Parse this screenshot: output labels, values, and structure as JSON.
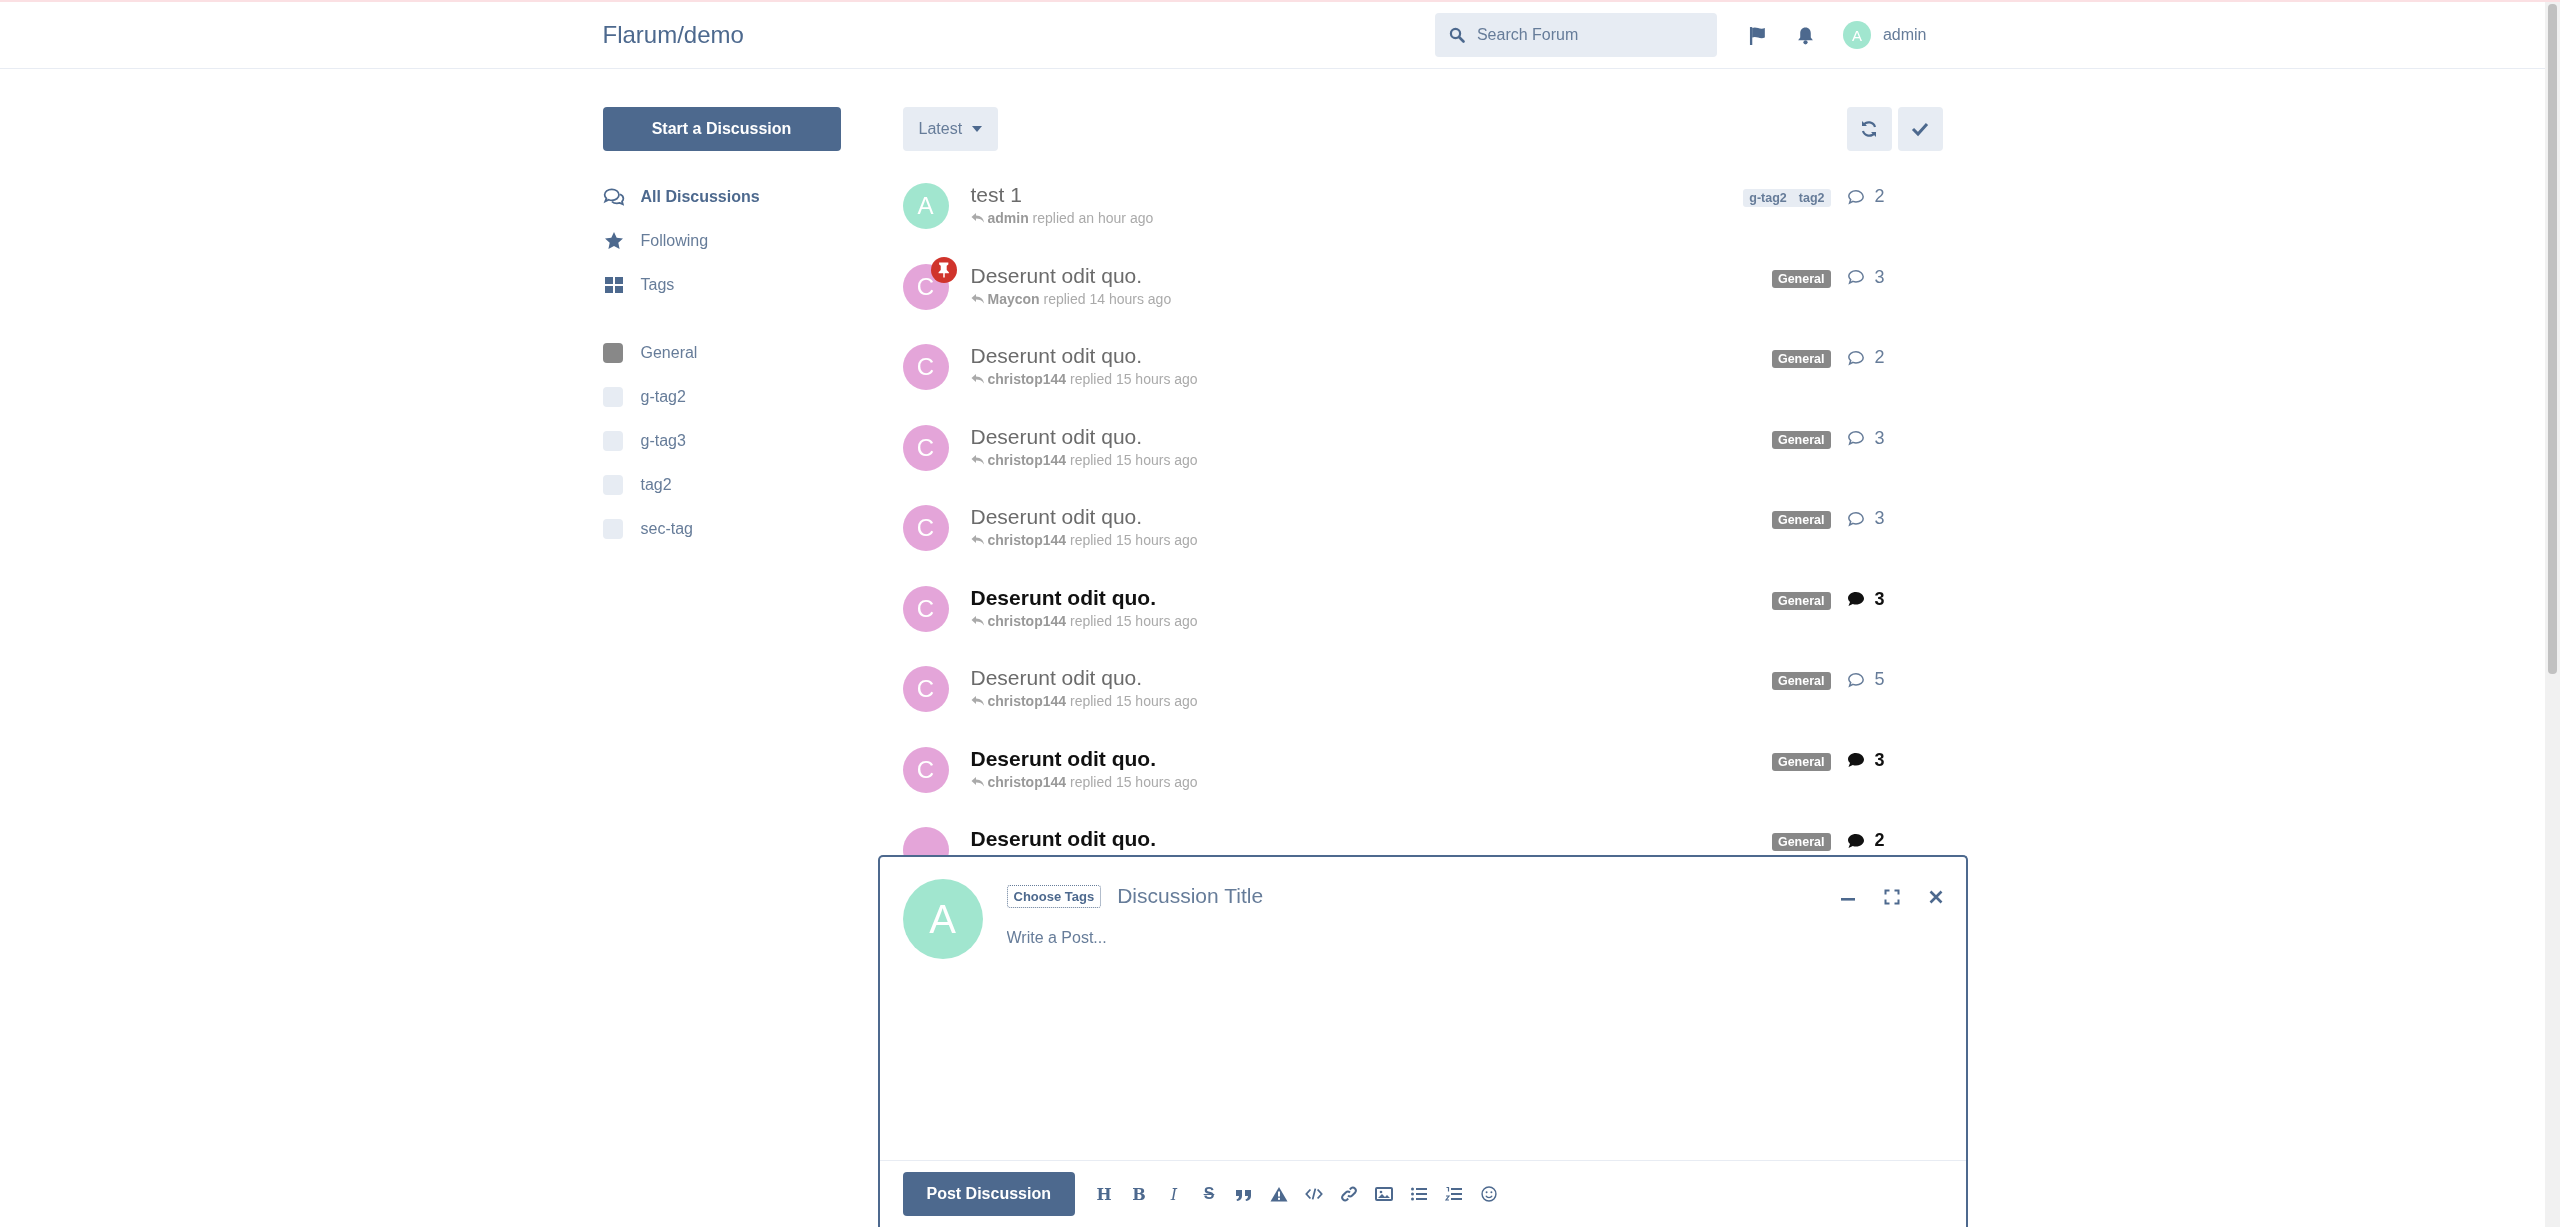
{
  "header": {
    "title": "Flarum/demo",
    "search": {
      "placeholder": "Search Forum"
    },
    "user": {
      "avatar_letter": "A",
      "name": "admin"
    }
  },
  "sidebar": {
    "start_button": "Start a Discussion",
    "nav": [
      {
        "label": "All Discussions",
        "kind": "discussions",
        "selected": true
      },
      {
        "label": "Following",
        "kind": "following",
        "selected": false
      },
      {
        "label": "Tags",
        "kind": "tags",
        "selected": false
      }
    ],
    "tags": [
      {
        "label": "General",
        "color": "#888888"
      },
      {
        "label": "g-tag2"
      },
      {
        "label": "g-tag3"
      },
      {
        "label": "tag2"
      },
      {
        "label": "sec-tag"
      }
    ]
  },
  "toolbar": {
    "sort": "Latest"
  },
  "discussions": [
    {
      "title": "test 1",
      "avatar": {
        "letter": "A",
        "color": "#a1e6cf"
      },
      "pinned": false,
      "unread": false,
      "meta": "**admin** replied an hour ago",
      "tags": [
        {
          "label": "g-tag2"
        },
        {
          "label": "tag2"
        }
      ],
      "replies": "2"
    },
    {
      "title": "Deserunt odit quo.",
      "avatar": {
        "letter": "C",
        "color": "#e4a5d9"
      },
      "pinned": true,
      "unread": false,
      "meta": "**Maycon** replied 14 hours ago",
      "tags": [
        {
          "label": "General",
          "color": "#888888"
        }
      ],
      "replies": "3"
    },
    {
      "title": "Deserunt odit quo.",
      "avatar": {
        "letter": "C",
        "color": "#e4a5d9"
      },
      "pinned": false,
      "unread": false,
      "meta": "**christop144** replied 15 hours ago",
      "tags": [
        {
          "label": "General",
          "color": "#888888"
        }
      ],
      "replies": "2"
    },
    {
      "title": "Deserunt odit quo.",
      "avatar": {
        "letter": "C",
        "color": "#e4a5d9"
      },
      "pinned": false,
      "unread": false,
      "meta": "**christop144** replied 15 hours ago",
      "tags": [
        {
          "label": "General",
          "color": "#888888"
        }
      ],
      "replies": "3"
    },
    {
      "title": "Deserunt odit quo.",
      "avatar": {
        "letter": "C",
        "color": "#e4a5d9"
      },
      "pinned": false,
      "unread": false,
      "meta": "**christop144** replied 15 hours ago",
      "tags": [
        {
          "label": "General",
          "color": "#888888"
        }
      ],
      "replies": "3"
    },
    {
      "title": "Deserunt odit quo.",
      "avatar": {
        "letter": "C",
        "color": "#e4a5d9"
      },
      "pinned": false,
      "unread": true,
      "meta": "**christop144** replied 15 hours ago",
      "tags": [
        {
          "label": "General",
          "color": "#888888"
        }
      ],
      "replies": "3"
    },
    {
      "title": "Deserunt odit quo.",
      "avatar": {
        "letter": "C",
        "color": "#e4a5d9"
      },
      "pinned": false,
      "unread": false,
      "meta": "**christop144** replied 15 hours ago",
      "tags": [
        {
          "label": "General",
          "color": "#888888"
        }
      ],
      "replies": "5"
    },
    {
      "title": "Deserunt odit quo.",
      "avatar": {
        "letter": "C",
        "color": "#e4a5d9"
      },
      "pinned": false,
      "unread": true,
      "meta": "**christop144** replied 15 hours ago",
      "tags": [
        {
          "label": "General",
          "color": "#888888"
        }
      ],
      "replies": "3"
    },
    {
      "title": "Deserunt odit quo.",
      "avatar": {
        "color": "#e4a5d9"
      },
      "pinned": false,
      "unread": true,
      "tags": [
        {
          "label": "General",
          "color": "#888888"
        }
      ],
      "replies": "2"
    }
  ],
  "composer": {
    "avatar": {
      "letter": "A",
      "color": "#a1e6cf"
    },
    "tags_button": "Choose Tags",
    "title_placeholder": "Discussion Title",
    "body_placeholder": "Write a Post...",
    "submit": "Post Discussion",
    "tools": [
      {
        "kind": "heading",
        "label": "H"
      },
      {
        "kind": "bold",
        "label": "B"
      },
      {
        "kind": "italic",
        "label": "I"
      },
      {
        "kind": "strike",
        "label": "S"
      },
      {
        "kind": "quote"
      },
      {
        "kind": "warning"
      },
      {
        "kind": "code"
      },
      {
        "kind": "link"
      },
      {
        "kind": "image"
      },
      {
        "kind": "list"
      },
      {
        "kind": "ordered"
      },
      {
        "kind": "emoji"
      }
    ]
  }
}
